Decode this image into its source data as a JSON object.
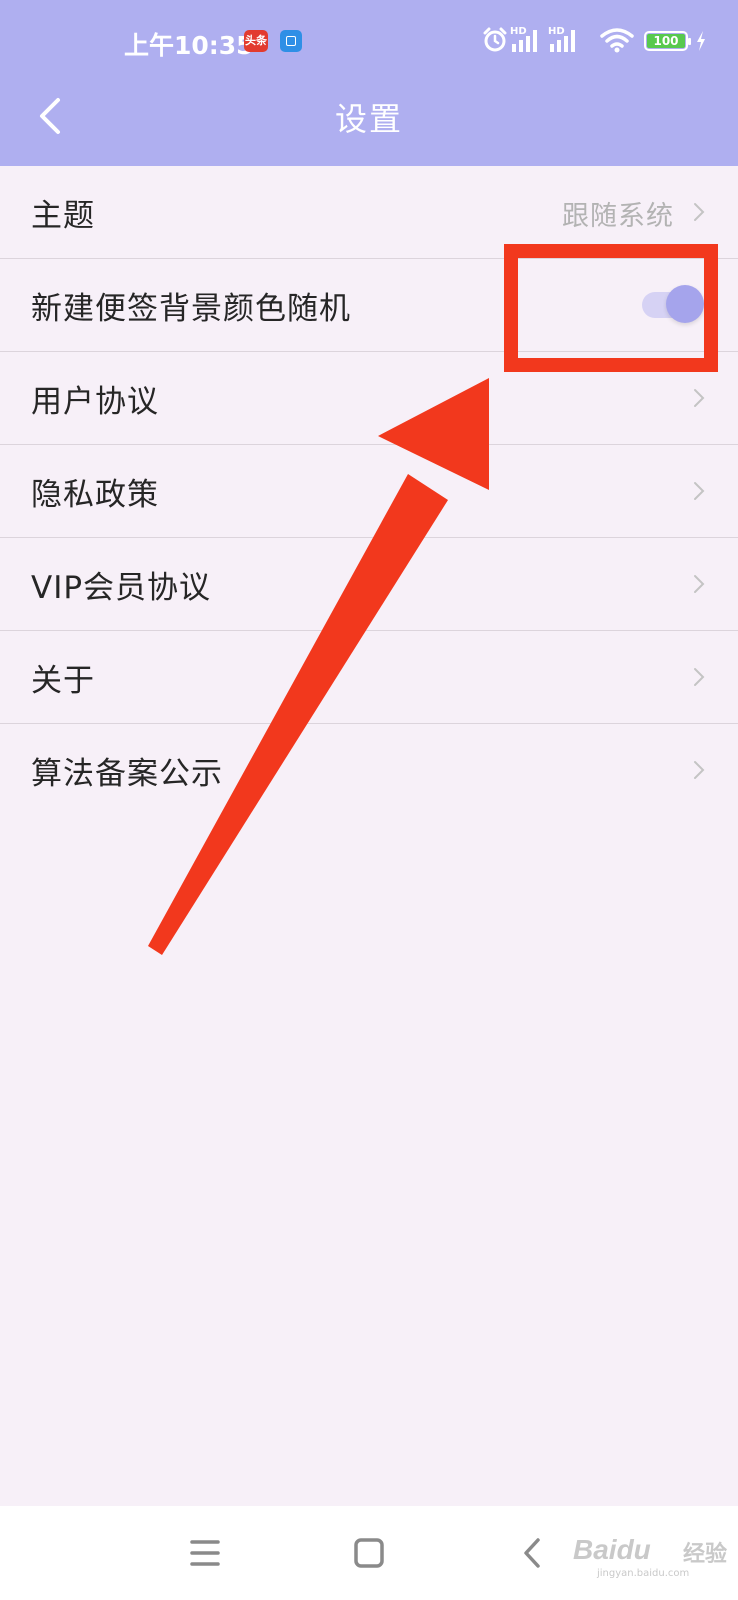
{
  "status_bar": {
    "time": "上午10:35",
    "badge_red_text": "头条",
    "battery_level": "100",
    "hd_label": "HD"
  },
  "header": {
    "title": "设置"
  },
  "settings": {
    "items": [
      {
        "label": "主题",
        "value": "跟随系统"
      },
      {
        "label": "新建便签背景颜色随机",
        "toggle_on": true
      },
      {
        "label": "用户协议"
      },
      {
        "label": "隐私政策"
      },
      {
        "label": "VIP会员协议"
      },
      {
        "label": "关于"
      },
      {
        "label": "算法备案公示"
      }
    ]
  },
  "watermark": {
    "brand": "Baidu",
    "cn": "经验",
    "url": "jingyan.baidu.com"
  },
  "colors": {
    "header": "#afaff0",
    "background": "#f7f0f8",
    "accent": "#a5a4ec",
    "annotation": "#f2381d"
  }
}
